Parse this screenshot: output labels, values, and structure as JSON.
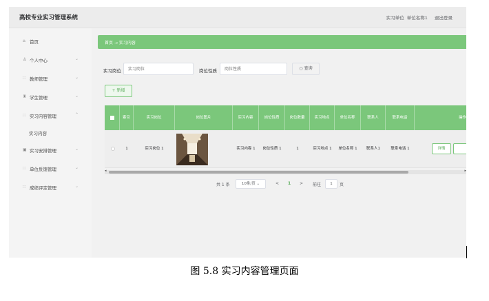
{
  "header": {
    "app_title": "高校专业实习管理系统",
    "role": "实习单位",
    "user": "单位名称1",
    "logout": "退出登录"
  },
  "sidebar": {
    "items": [
      {
        "icon": "home-icon",
        "label": "首页"
      },
      {
        "icon": "user-icon",
        "label": "个人中心"
      },
      {
        "icon": "grid-icon",
        "label": "教师管理"
      },
      {
        "icon": "student-icon",
        "label": "学生管理"
      },
      {
        "icon": "grid-icon",
        "label": "实习内容管理"
      },
      {
        "label": "实习内容"
      },
      {
        "icon": "calendar-icon",
        "label": "实习安排管理"
      },
      {
        "icon": "grid-icon",
        "label": "单位反馈管理"
      },
      {
        "icon": "grid-icon",
        "label": "成绩评定管理"
      }
    ]
  },
  "breadcrumb": {
    "home": "首页",
    "separator": "→",
    "current": "实习内容"
  },
  "search": {
    "field1_label": "实习岗位",
    "field1_placeholder": "实习岗位",
    "field2_label": "岗位性质",
    "field2_placeholder": "岗位性质",
    "button": "查询"
  },
  "toolbar": {
    "add_button": "+ 新增"
  },
  "table": {
    "columns": [
      "索引",
      "实习岗位",
      "岗位图片",
      "实习内容",
      "岗位性质",
      "岗位数量",
      "实习地点",
      "单位名称",
      "联系人",
      "联系电话",
      "操作"
    ],
    "rows": [
      {
        "index": "1",
        "position": "实习岗位 1",
        "content": "实习内容 1",
        "nature": "岗位性质 1",
        "quantity": "1",
        "location": "实习地点 1",
        "company": "单位名称 1",
        "contact": "联系人1",
        "phone": "联系电话 1",
        "detail_button": "详情"
      }
    ]
  },
  "pagination": {
    "total": "共 1 条",
    "page_size": "10条/页",
    "prev": "<",
    "current_page": "1",
    "next": ">",
    "goto_label": "前往",
    "goto_value": "1",
    "page_suffix": "页"
  },
  "caption": "图 5.8  实习内容管理页面",
  "colors": {
    "accent": "#7bc77b",
    "accent_text": "#5eae5e"
  }
}
